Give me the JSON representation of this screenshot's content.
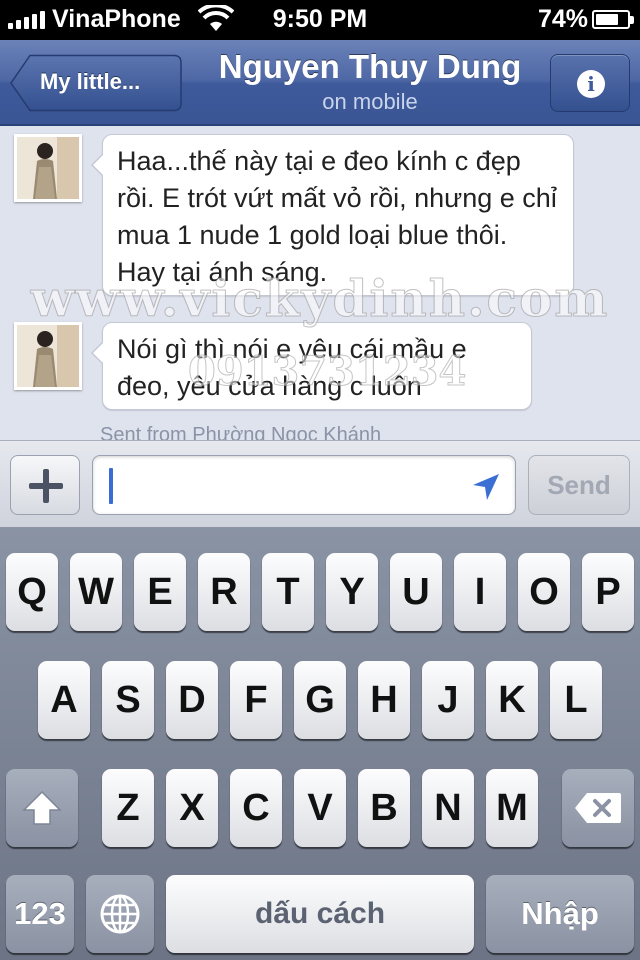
{
  "status_bar": {
    "carrier": "VinaPhone",
    "time": "9:50 PM",
    "battery": "74%",
    "battery_level": 0.74
  },
  "nav": {
    "back_label": "My little...",
    "title": "Nguyen Thuy Dung",
    "subtitle": "on mobile",
    "info_glyph": "i"
  },
  "messages": [
    {
      "text": "Haa...thế này tại e đeo kính c đẹp rồi. E trót vứt mất vỏ rồi, nhưng e chỉ mua 1 nude 1 gold loại blue thôi. Hay tại ánh sáng."
    },
    {
      "text": "Nói gì thì nói e yêu cái mầu e đeo, yêu cửa hàng c luôn"
    }
  ],
  "sent_from": "Sent from Phường Ngọc Khánh",
  "watermark": {
    "site": "www.vickydinh.com",
    "phone": "0913731234"
  },
  "compose": {
    "placeholder": "",
    "send_label": "Send",
    "add_icon": "plus-icon",
    "location_icon": "location-arrow-icon"
  },
  "keyboard": {
    "row1": [
      "Q",
      "W",
      "E",
      "R",
      "T",
      "Y",
      "U",
      "I",
      "O",
      "P"
    ],
    "row2": [
      "A",
      "S",
      "D",
      "F",
      "G",
      "H",
      "J",
      "K",
      "L"
    ],
    "row3": [
      "Z",
      "X",
      "C",
      "V",
      "B",
      "N",
      "M"
    ],
    "numbers_key": "123",
    "space_key": "dấu cách",
    "return_key": "Nhập",
    "shift_icon": "shift-arrow-icon",
    "delete_icon": "backspace-icon",
    "globe_icon": "globe-icon"
  }
}
